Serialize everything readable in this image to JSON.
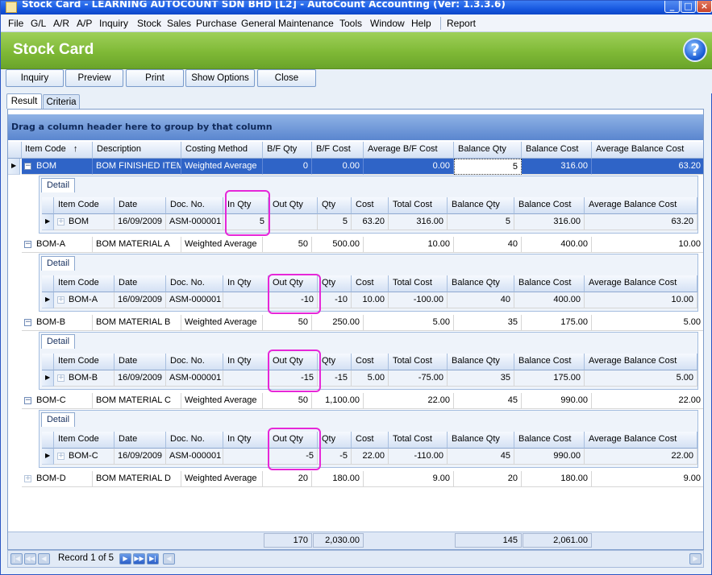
{
  "window": {
    "title": "Stock Card - LEARNING AUTOCOUNT SDN BHD [L2] - AutoCount Accounting (Ver: 1.3.3.6)"
  },
  "menu": [
    "File",
    "G/L",
    "A/R",
    "A/P",
    "Inquiry",
    "Stock",
    "Sales",
    "Purchase",
    "General Maintenance",
    "Tools",
    "Window",
    "Help",
    "Report"
  ],
  "header": {
    "title": "Stock Card",
    "help_icon": "?"
  },
  "toolbar": {
    "inquiry": "Inquiry",
    "preview": "Preview",
    "print": "Print",
    "show_options": "Show Options",
    "close": "Close"
  },
  "tabs": {
    "result": "Result",
    "criteria": "Criteria"
  },
  "grid": {
    "group_panel": "Drag a column header here to group by that column",
    "columns": [
      "Item Code",
      "Description",
      "Costing Method",
      "B/F Qty",
      "B/F Cost",
      "Average B/F Cost",
      "Balance Qty",
      "Balance Cost",
      "Average Balance Cost"
    ],
    "sort_indicator": "↑",
    "rows": [
      {
        "item_code": "BOM",
        "description": "BOM FINISHED ITEM",
        "costing_method": "Weighted Average",
        "bf_qty": "0",
        "bf_cost": "0.00",
        "avg_bf_cost": "0.00",
        "bal_qty": "5",
        "bal_cost": "316.00",
        "avg_bal_cost": "63.20"
      },
      {
        "item_code": "BOM-A",
        "description": "BOM MATERIAL A",
        "costing_method": "Weighted Average",
        "bf_qty": "50",
        "bf_cost": "500.00",
        "avg_bf_cost": "10.00",
        "bal_qty": "40",
        "bal_cost": "400.00",
        "avg_bal_cost": "10.00"
      },
      {
        "item_code": "BOM-B",
        "description": "BOM MATERIAL B",
        "costing_method": "Weighted Average",
        "bf_qty": "50",
        "bf_cost": "250.00",
        "avg_bf_cost": "5.00",
        "bal_qty": "35",
        "bal_cost": "175.00",
        "avg_bal_cost": "5.00"
      },
      {
        "item_code": "BOM-C",
        "description": "BOM MATERIAL C",
        "costing_method": "Weighted Average",
        "bf_qty": "50",
        "bf_cost": "1,100.00",
        "avg_bf_cost": "22.00",
        "bal_qty": "45",
        "bal_cost": "990.00",
        "avg_bal_cost": "22.00"
      },
      {
        "item_code": "BOM-D",
        "description": "BOM MATERIAL D",
        "costing_method": "Weighted Average",
        "bf_qty": "20",
        "bf_cost": "180.00",
        "avg_bf_cost": "9.00",
        "bal_qty": "20",
        "bal_cost": "180.00",
        "avg_bal_cost": "9.00"
      }
    ],
    "detail": {
      "tab": "Detail",
      "columns": [
        "Item Code",
        "Date",
        "Doc. No.",
        "In Qty",
        "Out Qty",
        "Qty",
        "Cost",
        "Total Cost",
        "Balance Qty",
        "Balance Cost",
        "Average Balance Cost"
      ],
      "rows": [
        {
          "item_code": "BOM",
          "date": "16/09/2009",
          "doc_no": "ASM-000001",
          "in_qty": "5",
          "out_qty": "",
          "qty": "5",
          "cost": "63.20",
          "total_cost": "316.00",
          "bal_qty": "5",
          "bal_cost": "316.00",
          "avg_bal_cost": "63.20"
        },
        {
          "item_code": "BOM-A",
          "date": "16/09/2009",
          "doc_no": "ASM-000001",
          "in_qty": "",
          "out_qty": "-10",
          "qty": "-10",
          "cost": "10.00",
          "total_cost": "-100.00",
          "bal_qty": "40",
          "bal_cost": "400.00",
          "avg_bal_cost": "10.00"
        },
        {
          "item_code": "BOM-B",
          "date": "16/09/2009",
          "doc_no": "ASM-000001",
          "in_qty": "",
          "out_qty": "-15",
          "qty": "-15",
          "cost": "5.00",
          "total_cost": "-75.00",
          "bal_qty": "35",
          "bal_cost": "175.00",
          "avg_bal_cost": "5.00"
        },
        {
          "item_code": "BOM-C",
          "date": "16/09/2009",
          "doc_no": "ASM-000001",
          "in_qty": "",
          "out_qty": "-5",
          "qty": "-5",
          "cost": "22.00",
          "total_cost": "-110.00",
          "bal_qty": "45",
          "bal_cost": "990.00",
          "avg_bal_cost": "22.00"
        }
      ]
    },
    "totals": {
      "bf_qty": "170",
      "bf_cost": "2,030.00",
      "bal_qty": "145",
      "bal_cost": "2,061.00"
    }
  },
  "navigator": {
    "record_text": "Record 1 of 5"
  },
  "colors": {
    "header_green": "#7fb936",
    "selection_blue": "#2f64c7",
    "highlight_magenta": "#e627d8"
  }
}
